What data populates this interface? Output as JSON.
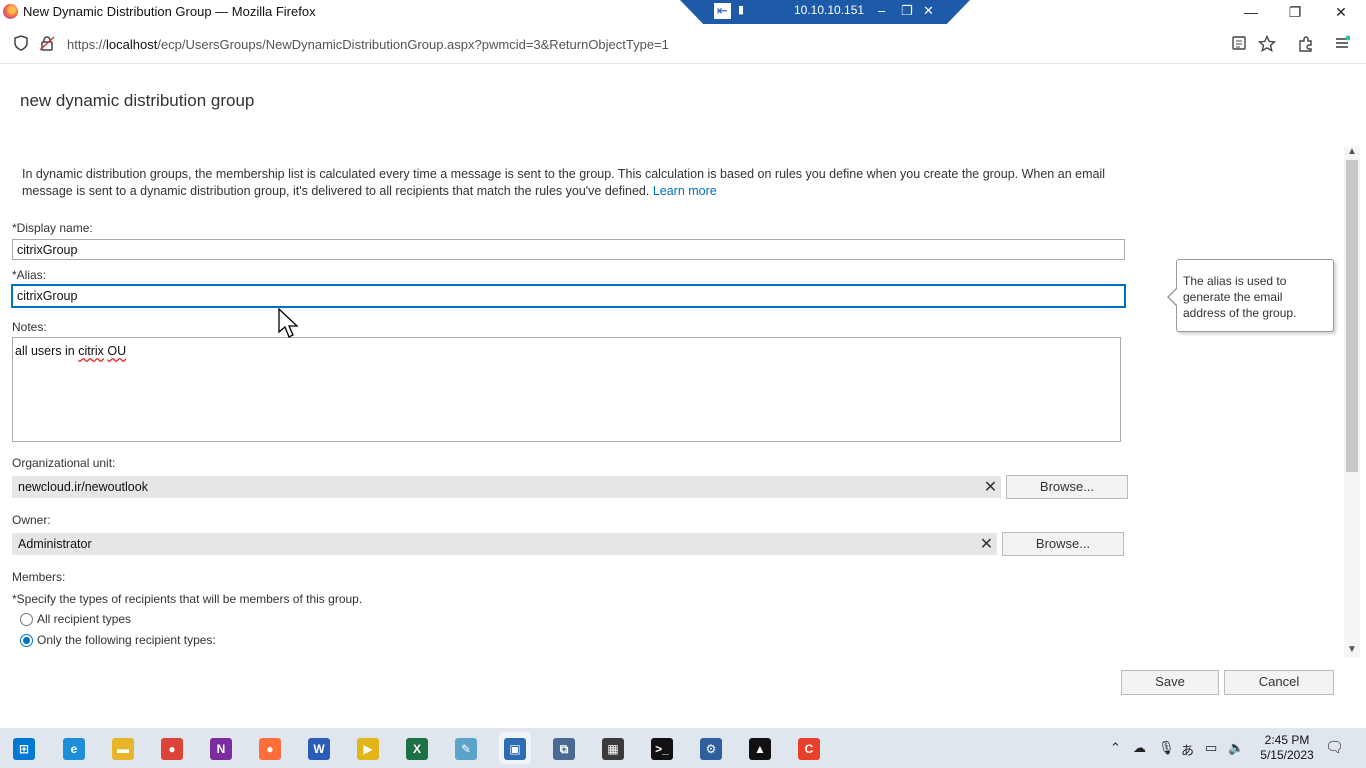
{
  "window": {
    "title": "New Dynamic Distribution Group — Mozilla Firefox",
    "minimize": "—",
    "restore": "❐",
    "close": "✕"
  },
  "remote_bar": {
    "host": "10.10.10.151",
    "pin": "⇤",
    "signal": "▮",
    "minimize": "–",
    "restore": "❐",
    "close": "✕"
  },
  "address_bar": {
    "prefix": "https://",
    "host": "localhost",
    "path": "/ecp/UsersGroups/NewDynamicDistributionGroup.aspx?pwmcid=3&ReturnObjectType=1",
    "icons": [
      "shield-icon",
      "lock-icon",
      "reader-view-icon",
      "bookmark-star-icon",
      "extensions-icon",
      "menu-icon"
    ]
  },
  "page": {
    "title": "new dynamic distribution group",
    "intro": "In dynamic distribution groups, the membership list is calculated every time a message is sent to the group. This calculation is based on rules you define when you create the group. When an email message is sent to a dynamic distribution group, it's delivered to all recipients that match the rules you've defined.",
    "learn_more": "Learn more"
  },
  "form": {
    "display_name": {
      "label": "*Display name:",
      "value": "citrixGroup"
    },
    "alias": {
      "label": "*Alias:",
      "value": "citrixGroup"
    },
    "notes": {
      "label": "Notes:",
      "value_before": "all users in ",
      "value_word1": "citrix",
      "value_space": " ",
      "value_word2": "OU"
    },
    "org_unit": {
      "label": "Organizational unit:",
      "value": "newcloud.ir/newoutlook",
      "clear": "✕",
      "browse": "Browse..."
    },
    "owner": {
      "label": "Owner:",
      "value": "Administrator",
      "clear": "✕",
      "browse": "Browse..."
    },
    "members": {
      "label": "Members:",
      "instruction": "*Specify the types of recipients that will be members of this group.",
      "options": [
        {
          "label": "All recipient types",
          "selected": false
        },
        {
          "label": "Only the following recipient types:",
          "selected": true
        }
      ]
    }
  },
  "callout": {
    "text": "The alias is used to generate the email address of the group."
  },
  "actions": {
    "save": "Save",
    "cancel": "Cancel"
  },
  "taskbar": {
    "time": "2:45 PM",
    "date": "5/15/2023",
    "apps": [
      {
        "name": "windows-start-icon",
        "glyph": "⊞",
        "color": "#0078d4"
      },
      {
        "name": "edge-icon",
        "glyph": "e",
        "color": "#1e8fd6"
      },
      {
        "name": "file-explorer-icon",
        "glyph": "▬",
        "color": "#e8b52a"
      },
      {
        "name": "chrome-icon",
        "glyph": "●",
        "color": "#dd4437"
      },
      {
        "name": "onenote-icon",
        "glyph": "N",
        "color": "#7b2d9f"
      },
      {
        "name": "firefox-icon",
        "glyph": "●",
        "color": "#ff6d3a"
      },
      {
        "name": "word-icon",
        "glyph": "W",
        "color": "#2b5cb8"
      },
      {
        "name": "vmware-player-icon",
        "glyph": "▶",
        "color": "#e2b618"
      },
      {
        "name": "excel-icon",
        "glyph": "X",
        "color": "#1e7144"
      },
      {
        "name": "notepad-icon",
        "glyph": "✎",
        "color": "#5aa3c9"
      },
      {
        "name": "remote-desktop-icon",
        "glyph": "▣",
        "color": "#2c6cb5"
      },
      {
        "name": "network-tool-icon",
        "glyph": "⧉",
        "color": "#4a6a96"
      },
      {
        "name": "server-manager-icon",
        "glyph": "▦",
        "color": "#3a3a3a"
      },
      {
        "name": "terminal-icon",
        "glyph": ">_",
        "color": "#111111"
      },
      {
        "name": "admin-tools-icon",
        "glyph": "⚙",
        "color": "#2f5f9c"
      },
      {
        "name": "photos-icon",
        "glyph": "▲",
        "color": "#111111"
      },
      {
        "name": "app-c-icon",
        "glyph": "C",
        "color": "#e8402a"
      }
    ],
    "tray": [
      "chevron-up-icon",
      "onedrive-icon",
      "microphone-icon",
      "ime-icon",
      "network-icon",
      "volume-icon",
      "notification-icon"
    ]
  },
  "colors": {
    "accent": "#0072c6",
    "remote_bar": "#1d5aa8",
    "taskbar": "#dfe6ee"
  }
}
